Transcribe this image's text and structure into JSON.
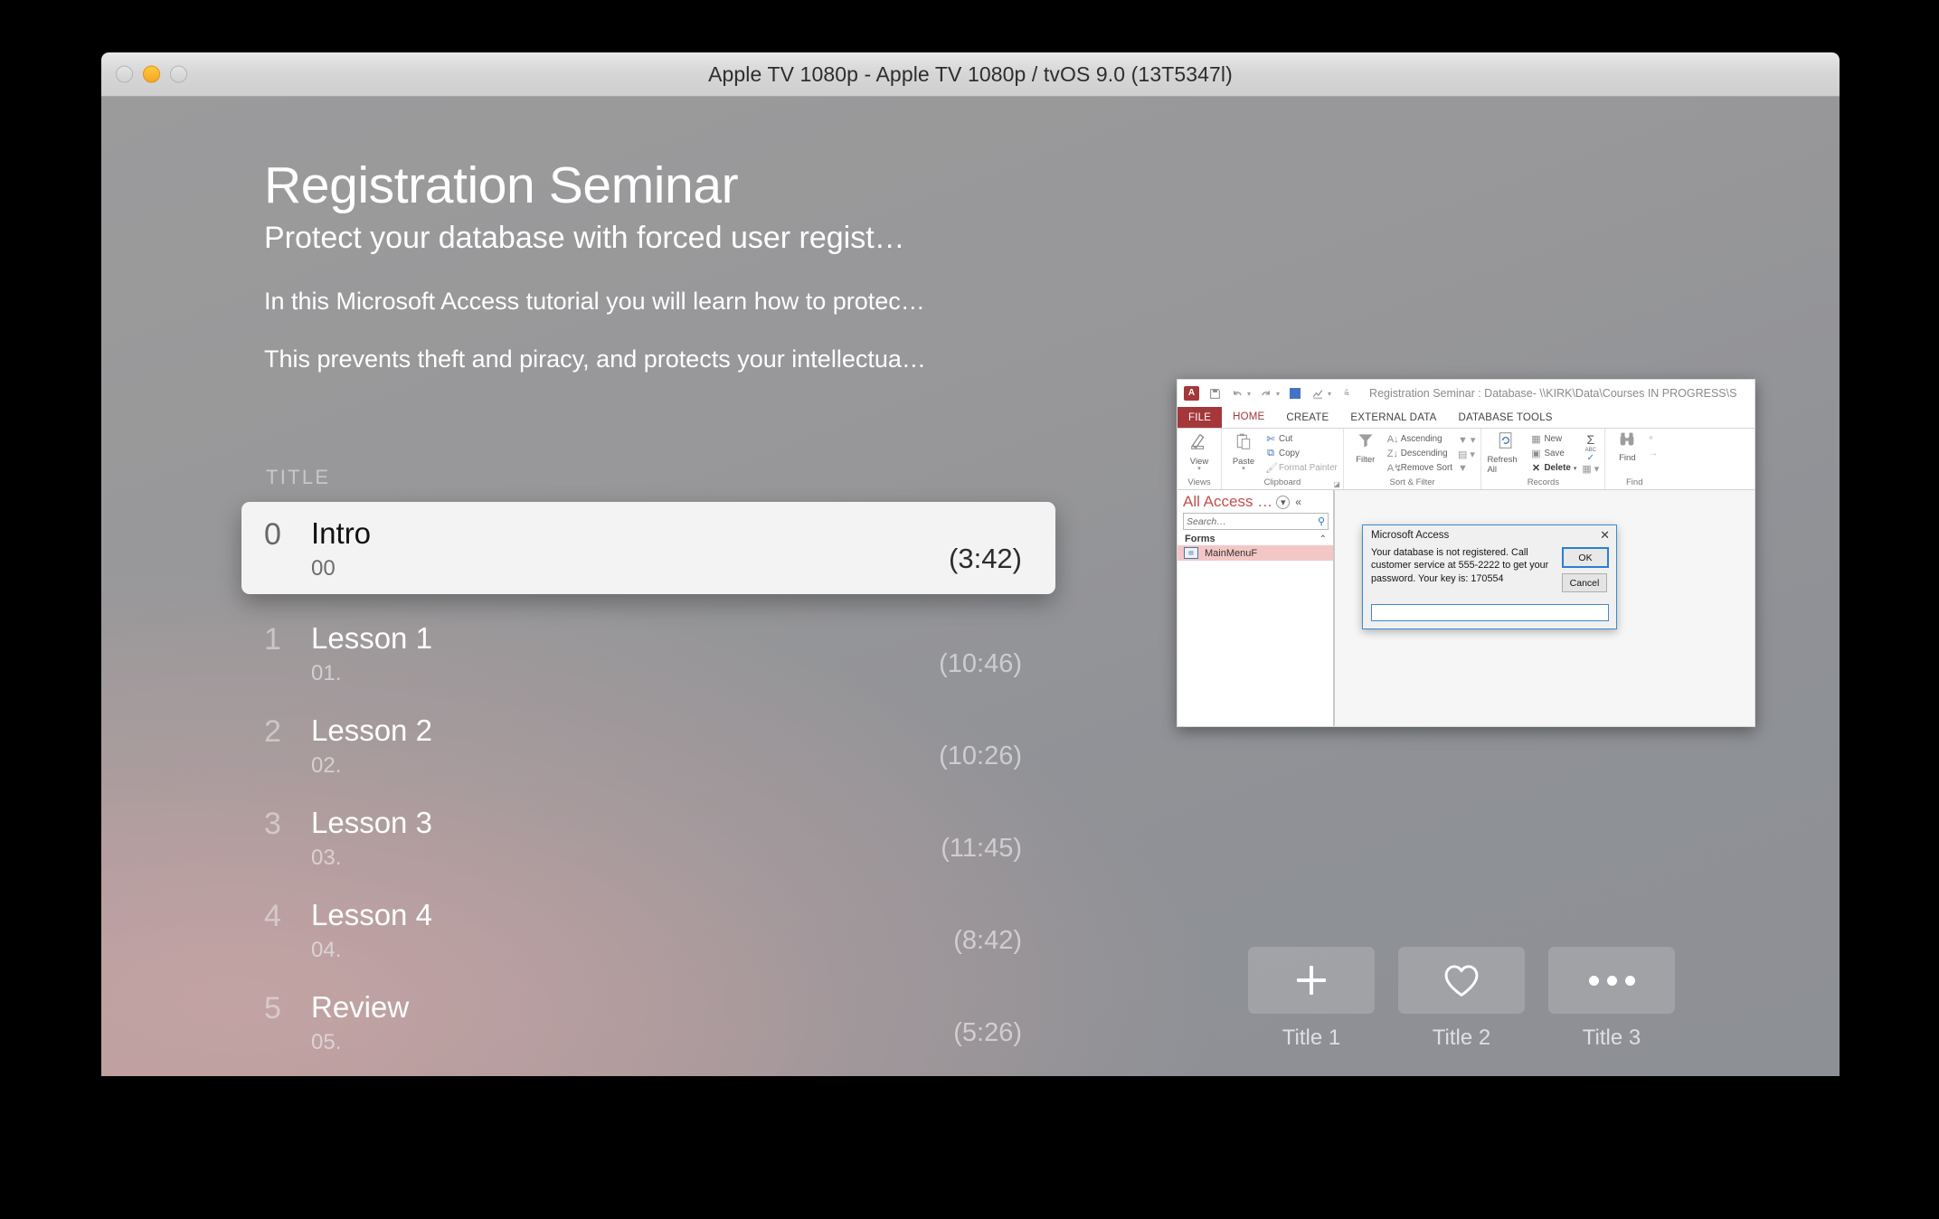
{
  "window": {
    "title": "Apple TV 1080p - Apple TV 1080p / tvOS 9.0 (13T5347l)",
    "traffic_lights": [
      "close",
      "minimize",
      "zoom"
    ]
  },
  "hero": {
    "title": "Registration Seminar",
    "subtitle": "Protect your database with forced user regist…",
    "paragraphs": [
      "In this Microsoft Access tutorial you will learn how to protec…",
      "This prevents theft and piracy, and protects your intellectua…"
    ]
  },
  "list": {
    "header": "TITLE",
    "rows": [
      {
        "index": "0",
        "title": "Intro",
        "subtitle": "00",
        "duration": "(3:42)",
        "focused": true
      },
      {
        "index": "1",
        "title": "Lesson 1",
        "subtitle": "01.",
        "duration": "(10:46)",
        "focused": false
      },
      {
        "index": "2",
        "title": "Lesson 2",
        "subtitle": "02.",
        "duration": "(10:26)",
        "focused": false
      },
      {
        "index": "3",
        "title": "Lesson 3",
        "subtitle": "03.",
        "duration": "(11:45)",
        "focused": false
      },
      {
        "index": "4",
        "title": "Lesson 4",
        "subtitle": "04.",
        "duration": "(8:42)",
        "focused": false
      },
      {
        "index": "5",
        "title": "Review",
        "subtitle": "05.",
        "duration": "(5:26)",
        "focused": false
      }
    ]
  },
  "actions": [
    {
      "label": "Title 1",
      "icon": "plus-icon"
    },
    {
      "label": "Title 2",
      "icon": "heart-icon"
    },
    {
      "label": "Title 3",
      "icon": "ellipsis-icon"
    }
  ],
  "thumbnail": {
    "app": "Microsoft Access",
    "qat": {
      "logo": "A",
      "buttons": [
        "save-icon",
        "undo-icon",
        "redo-icon",
        "color-swatch-icon",
        "chart-icon",
        "customize-icon"
      ],
      "title": "Registration Seminar : Database- \\\\KIRK\\Data\\Courses IN PROGRESS\\S"
    },
    "ribbon": {
      "tabs": [
        "FILE",
        "HOME",
        "CREATE",
        "EXTERNAL DATA",
        "DATABASE TOOLS"
      ],
      "active_tab": "HOME",
      "groups": [
        {
          "label": "Views",
          "big": [
            {
              "label": "View",
              "icon": "view-icon"
            }
          ],
          "small": []
        },
        {
          "label": "Clipboard",
          "big": [
            {
              "label": "Paste",
              "icon": "paste-icon"
            }
          ],
          "small": [
            {
              "label": "Cut",
              "icon": "scissors-icon"
            },
            {
              "label": "Copy",
              "icon": "copy-icon"
            },
            {
              "label": "Format Painter",
              "icon": "format-painter-icon"
            }
          ]
        },
        {
          "label": "Sort & Filter",
          "big": [
            {
              "label": "Filter",
              "icon": "funnel-icon"
            }
          ],
          "small": [
            {
              "label": "Ascending",
              "icon": "sort-az-icon"
            },
            {
              "label": "Descending",
              "icon": "sort-za-icon"
            },
            {
              "label": "Remove Sort",
              "icon": "remove-sort-icon"
            }
          ],
          "icons": [
            "advanced-filter-icon",
            "toggle-filter-icon",
            "filter-icon"
          ]
        },
        {
          "label": "Records",
          "big": [
            {
              "label": "Refresh All",
              "icon": "refresh-icon"
            }
          ],
          "small": [
            {
              "label": "New",
              "icon": "new-record-icon"
            },
            {
              "label": "Save",
              "icon": "save-record-icon"
            },
            {
              "label": "Delete",
              "icon": "delete-icon"
            }
          ],
          "icons": [
            "totals-sigma-icon",
            "spelling-abc-icon",
            "more-grid-icon"
          ]
        },
        {
          "label": "Find",
          "big": [
            {
              "label": "Find",
              "icon": "binoculars-icon"
            }
          ],
          "small": []
        }
      ]
    },
    "nav_pane": {
      "title": "All Access …",
      "search_placeholder": "Search…",
      "group": "Forms",
      "items": [
        {
          "label": "MainMenuF",
          "icon": "form-icon",
          "selected": true
        }
      ]
    },
    "dialog": {
      "title": "Microsoft Access",
      "message": "Your database is not registered. Call customer service at 555-2222 to get your password. Your key is: 170554",
      "buttons": [
        "OK",
        "Cancel"
      ],
      "input_value": "",
      "close_icon": "close-icon"
    }
  },
  "colors": {
    "access_red": "#a4373a",
    "dialog_border": "#3a8ad1",
    "nav_selected": "#f4c7c7",
    "focus_card": "#f3f3f3"
  }
}
